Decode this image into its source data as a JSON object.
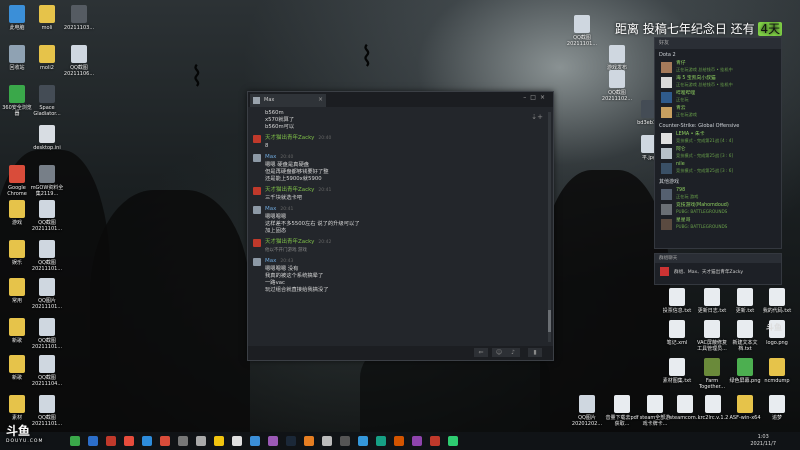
{
  "desktop_left": [
    {
      "label": "此电脑",
      "color": "#3b8fd8"
    },
    {
      "label": "moli",
      "color": "#e6c34a"
    },
    {
      "label": "20211103...",
      "color": "#555b62"
    },
    {
      "label": "回收站",
      "color": "#8fa2b3"
    },
    {
      "label": "moli2",
      "color": "#e6c34a"
    },
    {
      "label": "QQ截图 20211106...",
      "color": "#cfd7e0"
    },
    {
      "label": "360安全浏览器",
      "color": "#3aa84a"
    },
    {
      "label": "Space Gladiator...",
      "color": "#444c55"
    },
    {
      "label": "desktop.ini",
      "color": "#d8dde3"
    },
    {
      "label": "Google Chrome",
      "color": "#d94c3a"
    },
    {
      "label": "mGOW资料全集2119...",
      "color": "#777f88"
    },
    {
      "label": "游戏",
      "color": "#e6c34a"
    },
    {
      "label": "QQ截图 20211101...",
      "color": "#cfd7e0"
    },
    {
      "label": "娱乐",
      "color": "#e6c34a"
    },
    {
      "label": "QQ截图 20211101...",
      "color": "#cfd7e0"
    },
    {
      "label": "常用",
      "color": "#e6c34a"
    },
    {
      "label": "QQ图片 20211101...",
      "color": "#cfd7e0"
    },
    {
      "label": "新歌",
      "color": "#e6c34a"
    },
    {
      "label": "QQ截图 20211101...",
      "color": "#cfd7e0"
    },
    {
      "label": "新歌",
      "color": "#e6c34a"
    },
    {
      "label": "QQ截图 20211104...",
      "color": "#cfd7e0"
    },
    {
      "label": "素材",
      "color": "#e6c34a"
    },
    {
      "label": "QQ截图 20211101...",
      "color": "#cfd7e0"
    }
  ],
  "desktop_right": [
    {
      "label": "QQ截图 20211101...",
      "color": "#cfd7e0"
    },
    {
      "label": "游戏发布",
      "color": "#cfd7e0"
    },
    {
      "label": "QQ截图 20211102...",
      "color": "#cfd7e0"
    },
    {
      "label": "bd3eb1...",
      "color": "#444c55"
    },
    {
      "label": "平.jpg",
      "color": "#cfd7e0"
    },
    {
      "label": "投票信息.txt",
      "color": "#e8ecf0"
    },
    {
      "label": "更新日志.txt",
      "color": "#e8ecf0"
    },
    {
      "label": "更新.txt",
      "color": "#e8ecf0"
    },
    {
      "label": "我的代码.txt",
      "color": "#e8ecf0"
    },
    {
      "label": "笔记.xml",
      "color": "#e8ecf0"
    },
    {
      "label": "VAC屏蔽修复工具管理员...",
      "color": "#e8ecf0"
    },
    {
      "label": "新建文本文档.txt",
      "color": "#e8ecf0"
    },
    {
      "label": "logo.png",
      "color": "#e8ecf0"
    },
    {
      "label": "素材图集.txt",
      "color": "#e8ecf0"
    },
    {
      "label": "Farm Together...",
      "color": "#6a8a3a"
    },
    {
      "label": "绿色屏幕.png",
      "color": "#4caf50"
    },
    {
      "label": "ncmdump",
      "color": "#e6c34a"
    },
    {
      "label": "QQ图片 20201202...",
      "color": "#cfd7e0"
    },
    {
      "label": "音量下载去pdf获取...",
      "color": "#e8ecf0"
    },
    {
      "label": "steam全部游戏卡牌卡...",
      "color": "#e8ecf0"
    },
    {
      "label": "steamcom...",
      "color": "#e8ecf0"
    },
    {
      "label": "krc2lrc.v.1.2",
      "color": "#e8ecf0"
    },
    {
      "label": "ASF-win-x64",
      "color": "#e6c34a"
    },
    {
      "label": "追梦",
      "color": "#e8ecf0"
    }
  ],
  "overlay": {
    "text_before": "距离 投稿七年纪念日 还有 ",
    "num": "4天"
  },
  "chat": {
    "tab_name": "Max",
    "messages": [
      {
        "type": "line",
        "text": "b560m"
      },
      {
        "type": "line",
        "text": "x570就算了"
      },
      {
        "type": "line",
        "text": "b560m可以"
      },
      {
        "type": "hdr",
        "name": "天才猫出青年Zacky",
        "time": "20:40",
        "color": "#7fc048",
        "av": "#c0392b"
      },
      {
        "type": "line",
        "text": "8"
      },
      {
        "type": "hdr",
        "name": "Max",
        "time": "20:40",
        "color": "#6fa8dc",
        "av": "#8d99a6"
      },
      {
        "type": "line",
        "text": "嗯嗯 硬盘是真硬盘"
      },
      {
        "type": "line",
        "text": "但是再硬盘都够钱要好了整"
      },
      {
        "type": "line",
        "text": "还是能上5900x就5900"
      },
      {
        "type": "hdr",
        "name": "天才猫出青年Zacky",
        "time": "20:41",
        "color": "#7fc048",
        "av": "#c0392b"
      },
      {
        "type": "line",
        "text": "三千块就选卡吧"
      },
      {
        "type": "hdr",
        "name": "Max",
        "time": "20:41",
        "color": "#6fa8dc",
        "av": "#8d99a6"
      },
      {
        "type": "line",
        "text": "嗯嗯嗯嗯"
      },
      {
        "type": "line",
        "text": "这样差不多5500左右 说了的升级可以了"
      },
      {
        "type": "line",
        "text": "加上固态"
      },
      {
        "type": "hdr",
        "name": "天才猫出青年Zacky",
        "time": "20:42",
        "color": "#7fc048",
        "av": "#c0392b"
      },
      {
        "type": "sys",
        "text": "他以不开门游戏 游戏"
      },
      {
        "type": "hdr",
        "name": "Max",
        "time": "20:43",
        "color": "#6fa8dc",
        "av": "#8d99a6"
      },
      {
        "type": "line",
        "text": "嗯嗯嗯嗯 没有"
      },
      {
        "type": "line",
        "text": "我真的被这个系统搞晕了"
      },
      {
        "type": "line",
        "text": "一路vac"
      },
      {
        "type": "line",
        "text": "玩过组合就直接给我搞没了"
      }
    ]
  },
  "friends": {
    "search": "好友",
    "groups": [
      {
        "title": "Dota 2",
        "items": [
          {
            "name": "青仔",
            "status": "正在玩游戏 总给钱币 • 挂机中",
            "color": "#a67b5b",
            "off": false
          },
          {
            "name": "海 5 宝凯向小叔猫",
            "status": "正在玩游戏 总给钱币 • 挂机中",
            "color": "#d9d9d9",
            "off": false
          },
          {
            "name": "哔哩哔哩",
            "status": "正在玩",
            "color": "#2f5b8c",
            "off": false
          },
          {
            "name": "青云",
            "status": "正在玩游戏",
            "color": "#c8a060",
            "off": false
          }
        ]
      },
      {
        "title": "Counter-Strike: Global Offensive",
        "items": [
          {
            "name": "LEMA • 朱卡",
            "status": "竞技模式 - 完成第21战 [4 : 4]",
            "color": "#e0e0e0",
            "off": false
          },
          {
            "name": "阿仑",
            "status": "竞技模式 - 完成第25战 [3 : 6]",
            "color": "#b7c0c8",
            "off": false
          },
          {
            "name": "nile",
            "status": "竞技模式 - 完成第25战 [3 : 6]",
            "color": "#3a5066",
            "off": false
          }
        ]
      },
      {
        "title": "其他游戏",
        "items": [
          {
            "name": "798",
            "status": "正在玩 游戏",
            "color": "#556070",
            "off": false
          },
          {
            "name": "竞技游戏(Mahomdoud)",
            "status": "PUBG: BATTLEGROUNDS",
            "color": "#6a6f75",
            "off": false
          },
          {
            "name": "星星哥",
            "status": "PUBG: BATTLEGROUNDS",
            "color": "#5a4a40",
            "off": false
          }
        ]
      }
    ]
  },
  "groupchat": {
    "header": "群组聊天",
    "text": "群组、Max、天才猫出青年Zacky"
  },
  "taskbar": {
    "time": "1:03",
    "date": "2021/11/7"
  },
  "watermark": {
    "main": "斗鱼",
    "sub": "DOUYU.COM"
  },
  "fish": "斗鱼"
}
